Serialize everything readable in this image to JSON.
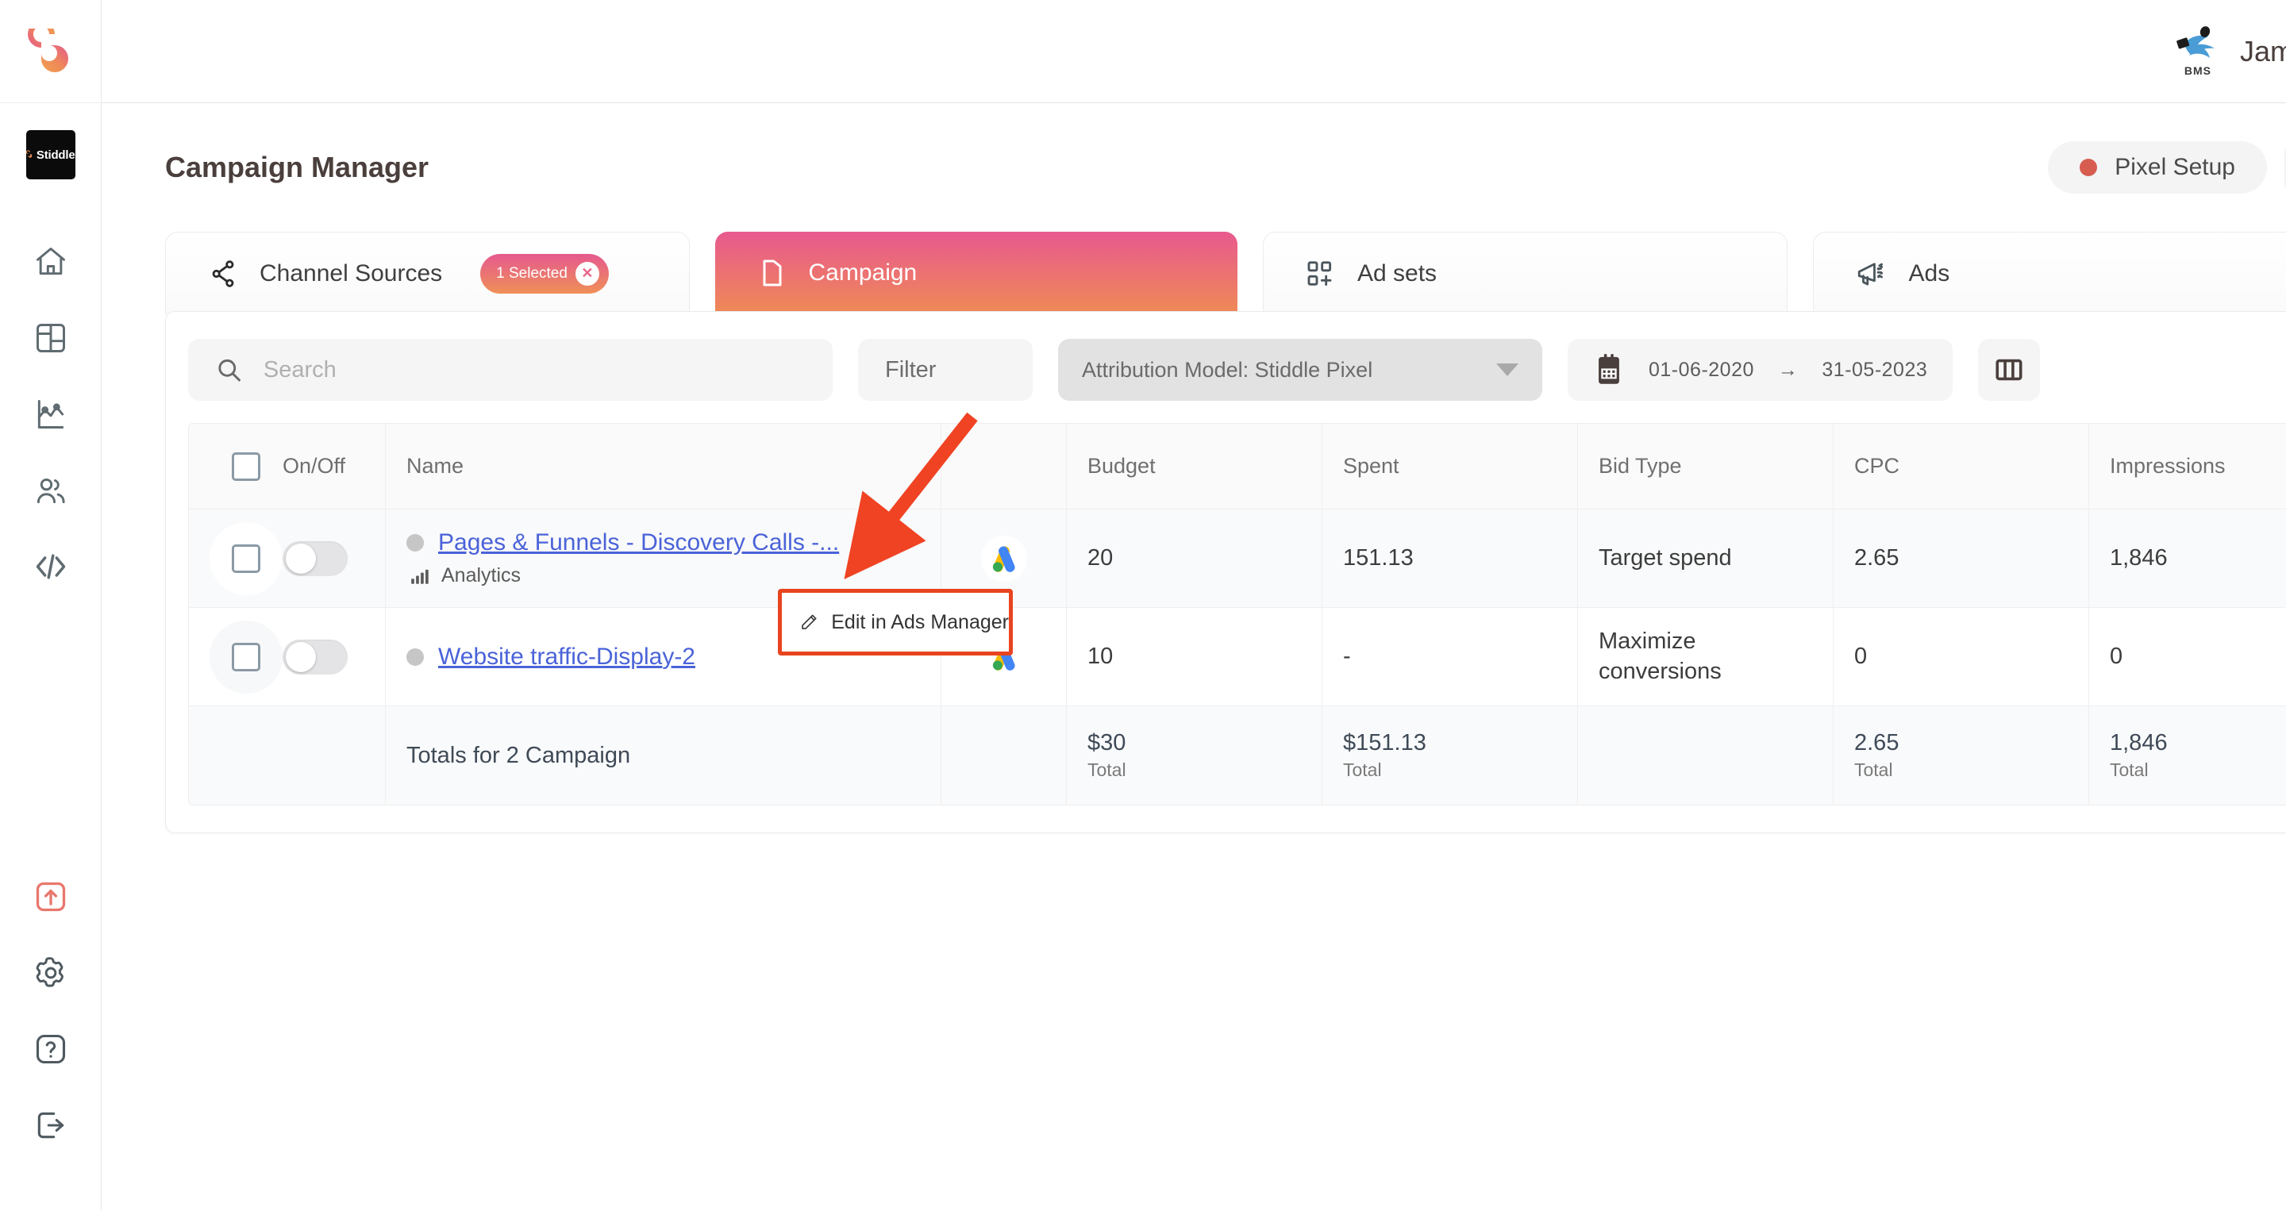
{
  "brand": {
    "name": "Stiddle",
    "logo_icon": "stiddle-logo-icon"
  },
  "sidebar": {
    "items": [
      {
        "icon": "home-icon",
        "name": "home"
      },
      {
        "icon": "dashboard-grid-icon",
        "name": "dashboard"
      },
      {
        "icon": "analytics-chart-icon",
        "name": "analytics"
      },
      {
        "icon": "users-icon",
        "name": "audience"
      },
      {
        "icon": "code-icon",
        "name": "developers"
      }
    ],
    "bottom_items": [
      {
        "icon": "upgrade-arrow-icon",
        "name": "upgrade"
      },
      {
        "icon": "gear-icon",
        "name": "settings"
      },
      {
        "icon": "help-question-icon",
        "name": "help"
      },
      {
        "icon": "logout-icon",
        "name": "logout"
      }
    ]
  },
  "topbar": {
    "account_logo_text": "BMS",
    "user_name": "James"
  },
  "header": {
    "title": "Campaign Manager",
    "pixel_setup_label": "Pixel Setup",
    "pixel_dot_color": "#d65d4f",
    "refresh_icon": "refresh-icon"
  },
  "tabs": [
    {
      "label": "Channel Sources",
      "icon": "share-nodes-icon",
      "active": false,
      "badge": {
        "text": "1 Selected",
        "close_icon": "close-icon"
      }
    },
    {
      "label": "Campaign",
      "icon": "folder-icon",
      "active": true
    },
    {
      "label": "Ad sets",
      "icon": "adsets-grid-icon",
      "active": false
    },
    {
      "label": "Ads",
      "icon": "megaphone-icon",
      "active": false
    }
  ],
  "toolbar": {
    "search_placeholder": "Search",
    "search_value": "",
    "search_icon": "search-icon",
    "filter_label": "Filter",
    "attribution_label": "Attribution Model: Stiddle Pixel",
    "calendar_icon": "calendar-icon",
    "date_start": "01-06-2020",
    "date_arrow": "→",
    "date_end": "31-05-2023",
    "columns_icon": "columns-icon"
  },
  "table": {
    "columns": [
      "On/Off",
      "Name",
      "",
      "Budget",
      "Spent",
      "Bid Type",
      "CPC",
      "Impressions"
    ],
    "rows": [
      {
        "name": "Pages & Funnels - Discovery Calls -...",
        "sub_label": "Analytics",
        "sub_icon": "bar-chart-icon",
        "platform_icon": "google-ads-icon",
        "budget": "20",
        "spent": "151.13",
        "bid_type": "Target spend",
        "cpc": "2.65",
        "impressions": "1,846"
      },
      {
        "name": "Website traffic-Display-2",
        "sub_label": "",
        "platform_icon": "google-ads-icon",
        "budget": "10",
        "spent": "-",
        "bid_type": "Maximize conversions",
        "cpc": "0",
        "impressions": "0"
      }
    ],
    "totals": {
      "label": "Totals for 2 Campaign",
      "budget": "$30",
      "budget_sub": "Total",
      "spent": "$151.13",
      "spent_sub": "Total",
      "bid_type": "",
      "cpc": "2.65",
      "cpc_sub": "Total",
      "impressions": "1,846",
      "impressions_sub": "Total"
    }
  },
  "overlay": {
    "edit_tooltip_label": "Edit in Ads Manager",
    "edit_tooltip_icon": "pencil-icon",
    "highlight_color": "#e8441f",
    "annotation_arrow_color": "#f04323"
  }
}
